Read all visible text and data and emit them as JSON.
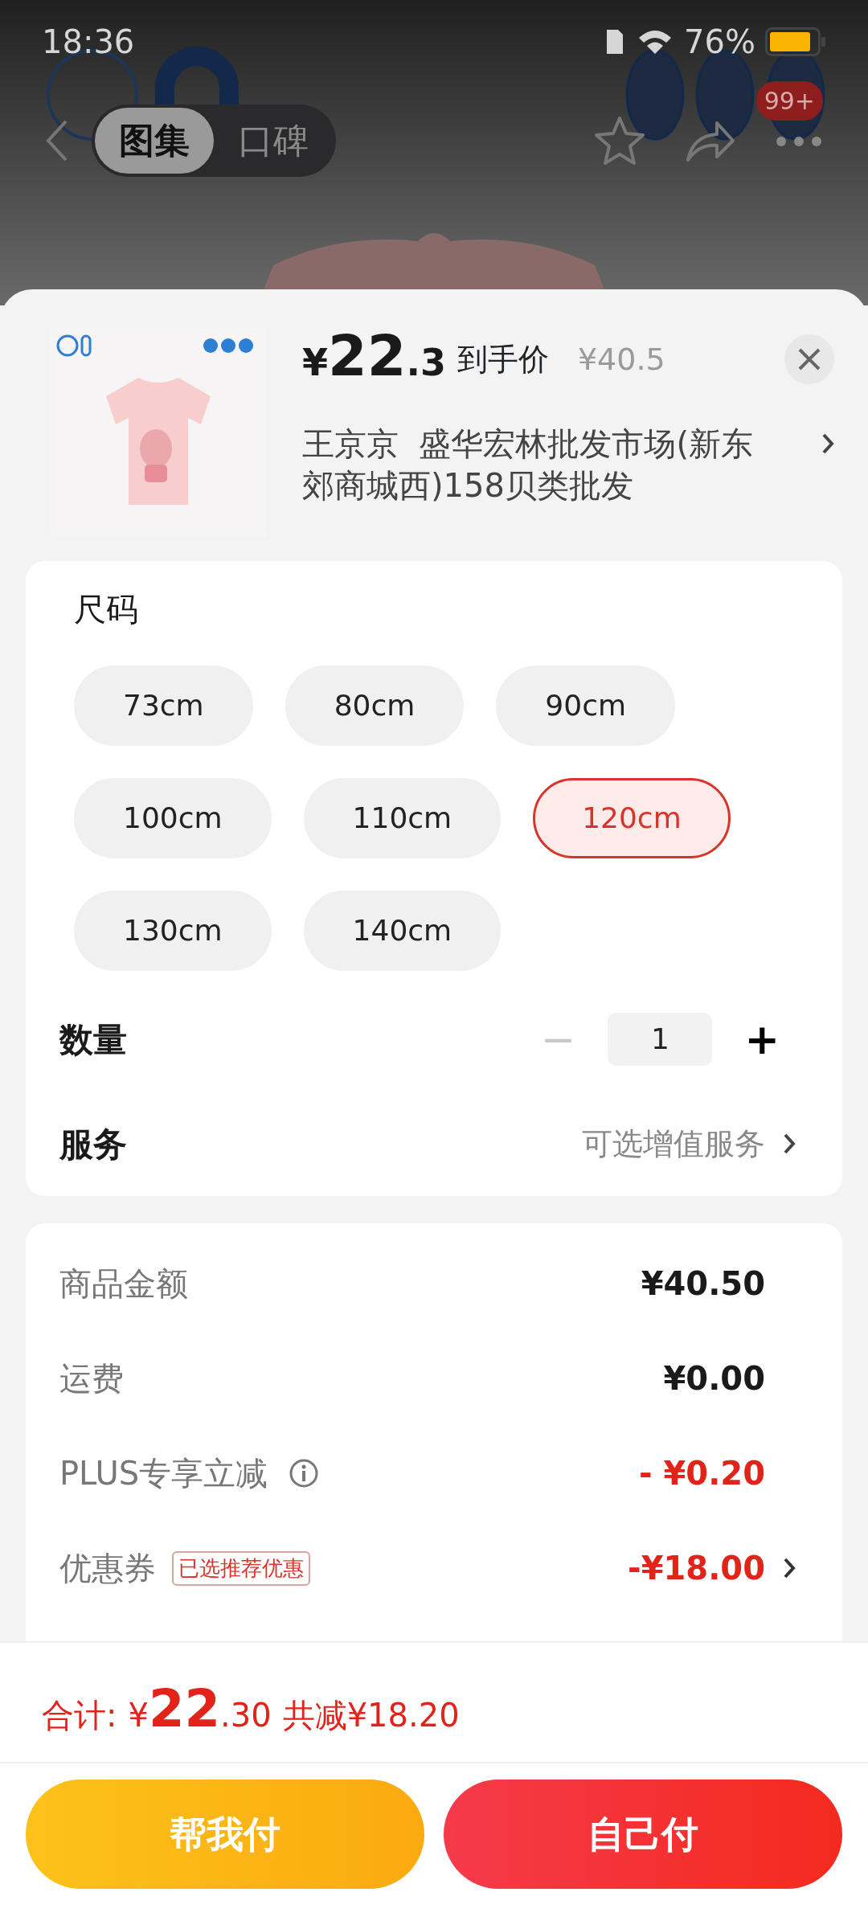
{
  "status_bar": {
    "time": "18:36",
    "battery": "76%"
  },
  "nav": {
    "tabs": [
      {
        "label": "图集",
        "selected": true
      },
      {
        "label": "口碑",
        "selected": false
      }
    ],
    "cart_badge": "99+"
  },
  "product": {
    "currency": "¥",
    "price_main": "22",
    "price_decimal": ".3",
    "price_label": "到手价",
    "original_price": "¥40.5",
    "shop": "王京京  盛华宏林批发市场(新东郊商城西)158贝类批发"
  },
  "sizes": {
    "title": "尺码",
    "options": [
      {
        "label": "73cm",
        "selected": false
      },
      {
        "label": "80cm",
        "selected": false
      },
      {
        "label": "90cm",
        "selected": false
      },
      {
        "label": "100cm",
        "selected": false
      },
      {
        "label": "110cm",
        "selected": false
      },
      {
        "label": "120cm",
        "selected": true
      },
      {
        "label": "130cm",
        "selected": false
      },
      {
        "label": "140cm",
        "selected": false
      }
    ]
  },
  "quantity": {
    "label": "数量",
    "minus": {
      "symbol": "−",
      "disabled": true
    },
    "value": "1",
    "plus": {
      "symbol": "+",
      "disabled": false
    }
  },
  "service": {
    "label": "服务",
    "value": "可选增值服务"
  },
  "summary": [
    {
      "label": "商品金额",
      "value": "¥40.50",
      "kind": "plain",
      "info": false,
      "link": false
    },
    {
      "label": "运费",
      "value": "¥0.00",
      "kind": "plain",
      "info": false,
      "link": false
    },
    {
      "label": "PLUS专享立减",
      "value": "- ¥0.20",
      "kind": "discount",
      "info": true,
      "link": false
    },
    {
      "label": "优惠券",
      "tag": "已选推荐优惠",
      "value": "-¥18.00",
      "kind": "discount",
      "info": false,
      "link": true
    }
  ],
  "total": {
    "label": "合计:",
    "currency": "¥",
    "main": "22",
    "decimal": ".30",
    "saved": "共减¥18.20"
  },
  "buttons": [
    {
      "label": "帮我付",
      "kind": "secondary"
    },
    {
      "label": "自己付",
      "kind": "primary"
    }
  ]
}
